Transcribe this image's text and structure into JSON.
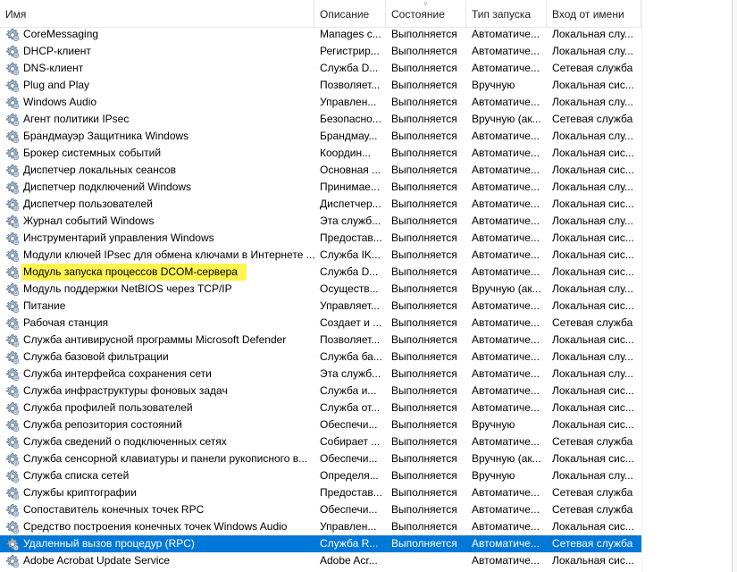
{
  "columns": {
    "name": "Имя",
    "description": "Описание",
    "state": "Состояние",
    "startup": "Тип запуска",
    "logon": "Вход от имени"
  },
  "sort_indicator": "˅",
  "services": [
    {
      "name": "CoreMessaging",
      "description": "Manages c...",
      "state": "Выполняется",
      "startup": "Автоматиче...",
      "logon": "Локальная слу..."
    },
    {
      "name": "DHCP-клиент",
      "description": "Регистрир...",
      "state": "Выполняется",
      "startup": "Автоматиче...",
      "logon": "Локальная слу..."
    },
    {
      "name": "DNS-клиент",
      "description": "Служба D...",
      "state": "Выполняется",
      "startup": "Автоматиче...",
      "logon": "Сетевая служба"
    },
    {
      "name": "Plug and Play",
      "description": "Позволяет...",
      "state": "Выполняется",
      "startup": "Вручную",
      "logon": "Локальная сис..."
    },
    {
      "name": "Windows Audio",
      "description": "Управлен...",
      "state": "Выполняется",
      "startup": "Автоматиче...",
      "logon": "Локальная слу..."
    },
    {
      "name": "Агент политики IPsec",
      "description": "Безопасно...",
      "state": "Выполняется",
      "startup": "Вручную (ак...",
      "logon": "Сетевая служба"
    },
    {
      "name": "Брандмауэр Защитника Windows",
      "description": "Брандмау...",
      "state": "Выполняется",
      "startup": "Автоматиче...",
      "logon": "Локальная слу..."
    },
    {
      "name": "Брокер системных событий",
      "description": "Координ...",
      "state": "Выполняется",
      "startup": "Автоматиче...",
      "logon": "Локальная сис..."
    },
    {
      "name": "Диспетчер локальных сеансов",
      "description": "Основная ...",
      "state": "Выполняется",
      "startup": "Автоматиче...",
      "logon": "Локальная сис..."
    },
    {
      "name": "Диспетчер подключений Windows",
      "description": "Принимае...",
      "state": "Выполняется",
      "startup": "Автоматиче...",
      "logon": "Локальная слу..."
    },
    {
      "name": "Диспетчер пользователей",
      "description": "Диспетчер...",
      "state": "Выполняется",
      "startup": "Автоматиче...",
      "logon": "Локальная сис..."
    },
    {
      "name": "Журнал событий Windows",
      "description": "Эта служб...",
      "state": "Выполняется",
      "startup": "Автоматиче...",
      "logon": "Локальная слу..."
    },
    {
      "name": "Инструментарий управления Windows",
      "description": "Предостав...",
      "state": "Выполняется",
      "startup": "Автоматиче...",
      "logon": "Локальная сис..."
    },
    {
      "name": "Модули ключей IPsec для обмена ключами в Интернете ...",
      "description": "Служба IK...",
      "state": "Выполняется",
      "startup": "Автоматиче...",
      "logon": "Локальная сис..."
    },
    {
      "name": "Модуль запуска процессов DCOM-сервера",
      "description": "Служба D...",
      "state": "Выполняется",
      "startup": "Автоматиче...",
      "logon": "Локальная сис...",
      "highlighted": true
    },
    {
      "name": "Модуль поддержки NetBIOS через TCP/IP",
      "description": "Осуществ...",
      "state": "Выполняется",
      "startup": "Вручную (ак...",
      "logon": "Локальная слу..."
    },
    {
      "name": "Питание",
      "description": "Управляет...",
      "state": "Выполняется",
      "startup": "Автоматиче...",
      "logon": "Локальная сис..."
    },
    {
      "name": "Рабочая станция",
      "description": "Создает и ...",
      "state": "Выполняется",
      "startup": "Автоматиче...",
      "logon": "Сетевая служба"
    },
    {
      "name": "Служба антивирусной программы Microsoft Defender",
      "description": "Позволяет...",
      "state": "Выполняется",
      "startup": "Автоматиче...",
      "logon": "Локальная сис..."
    },
    {
      "name": "Служба базовой фильтрации",
      "description": "Служба ба...",
      "state": "Выполняется",
      "startup": "Автоматиче...",
      "logon": "Локальная слу..."
    },
    {
      "name": "Служба интерфейса сохранения сети",
      "description": "Эта служб...",
      "state": "Выполняется",
      "startup": "Автоматиче...",
      "logon": "Локальная слу..."
    },
    {
      "name": "Служба инфраструктуры фоновых задач",
      "description": "Служба и...",
      "state": "Выполняется",
      "startup": "Автоматиче...",
      "logon": "Локальная сис..."
    },
    {
      "name": "Служба профилей пользователей",
      "description": "Служба от...",
      "state": "Выполняется",
      "startup": "Автоматиче...",
      "logon": "Локальная сис..."
    },
    {
      "name": "Служба репозитория состояний",
      "description": "Обеспечи...",
      "state": "Выполняется",
      "startup": "Вручную",
      "logon": "Локальная сис..."
    },
    {
      "name": "Служба сведений о подключенных сетях",
      "description": "Собирает ...",
      "state": "Выполняется",
      "startup": "Автоматиче...",
      "logon": "Сетевая служба"
    },
    {
      "name": "Служба сенсорной клавиатуры и панели рукописного в...",
      "description": "Обеспечи...",
      "state": "Выполняется",
      "startup": "Вручную (ак...",
      "logon": "Локальная сис..."
    },
    {
      "name": "Служба списка сетей",
      "description": "Определя...",
      "state": "Выполняется",
      "startup": "Вручную",
      "logon": "Локальная слу..."
    },
    {
      "name": "Службы криптографии",
      "description": "Предостав...",
      "state": "Выполняется",
      "startup": "Автоматиче...",
      "logon": "Сетевая служба"
    },
    {
      "name": "Сопоставитель конечных точек RPC",
      "description": "Обеспечи...",
      "state": "Выполняется",
      "startup": "Автоматиче...",
      "logon": "Сетевая служба"
    },
    {
      "name": "Средство построения конечных точек Windows Audio",
      "description": "Управлен...",
      "state": "Выполняется",
      "startup": "Автоматиче...",
      "logon": "Локальная сис..."
    },
    {
      "name": "Удаленный вызов процедур (RPC)",
      "description": "Служба R...",
      "state": "Выполняется",
      "startup": "Автоматиче...",
      "logon": "Сетевая служба",
      "selected": true
    },
    {
      "name": "Adobe Acrobat Update Service",
      "description": "Adobe Acr...",
      "state": "",
      "startup": "Автоматиче...",
      "logon": "Локальная сис..."
    }
  ],
  "colors": {
    "selection": "#0078d7",
    "highlight": "#fff44f",
    "icon": "service-gear-icon"
  }
}
